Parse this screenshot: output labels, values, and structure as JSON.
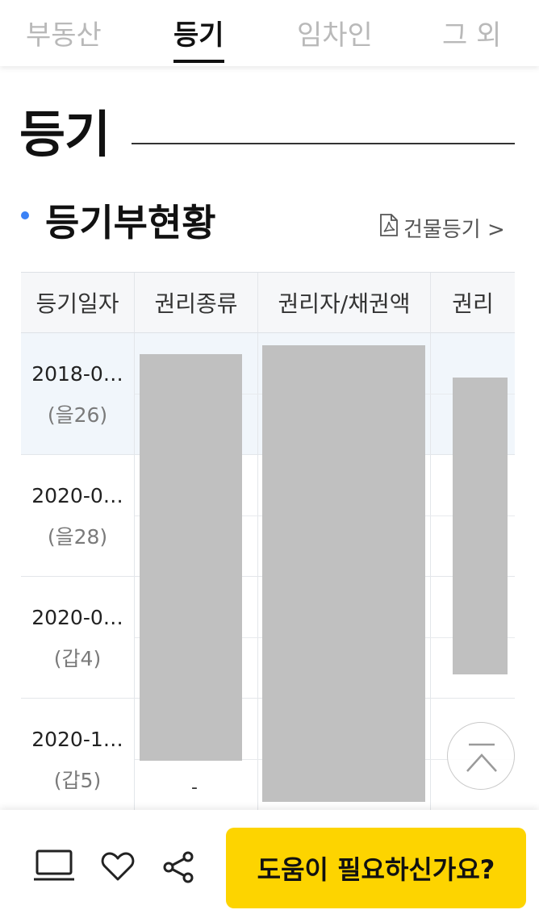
{
  "tabs": [
    {
      "label": "부동산"
    },
    {
      "label": "등기"
    },
    {
      "label": "임차인"
    },
    {
      "label": "그 외"
    }
  ],
  "section": {
    "title": "등기"
  },
  "registry": {
    "title": "등기부현황",
    "doc_link": "건물등기 >",
    "columns": [
      "등기일자",
      "권리종류",
      "권리자/채권액",
      "권리"
    ],
    "rows": [
      {
        "date": "2018-0…",
        "rank": "(을26)"
      },
      {
        "date": "2020-0…",
        "rank": "(을28)"
      },
      {
        "date": "2020-0…",
        "rank": "(갑4)"
      },
      {
        "date": "2020-1…",
        "rank": "(갑5)",
        "type": "-"
      }
    ]
  },
  "bottom": {
    "help_button": "도움이 필요하신가요?",
    "icons": [
      "laptop-icon",
      "heart-icon",
      "share-icon"
    ]
  },
  "colors": {
    "accent": "#fdd400",
    "bullet": "#3b82f6",
    "highlight_row": "#f1f6fb"
  }
}
